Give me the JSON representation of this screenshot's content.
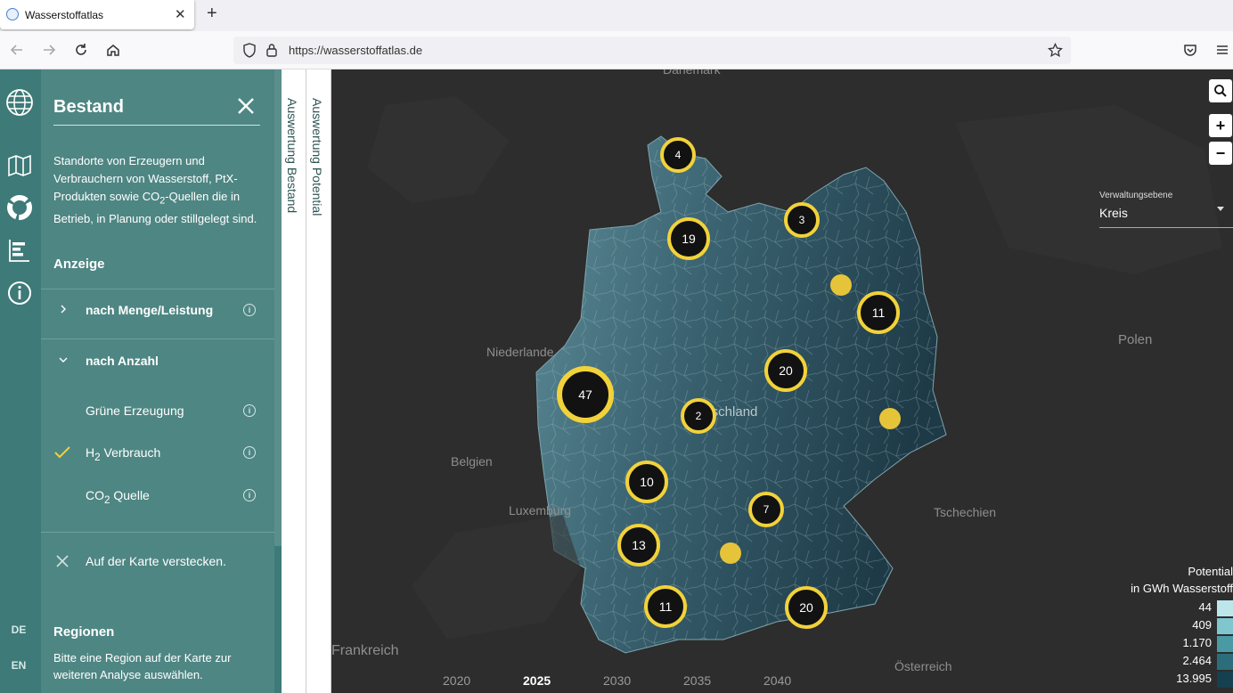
{
  "browser": {
    "tab_title": "Wasserstoffatlas",
    "new_tab": "+",
    "url": "https://wasserstoffatlas.de"
  },
  "panel": {
    "title": "Bestand",
    "description_html": "Standorte von Erzeugern und Verbrauchern von Wasserstoff, PtX-Produkten sowie CO<sub>2</sub>-Quellen die in Betrieb, in Planung oder stillgelegt sind.",
    "anzeige": "Anzeige",
    "rows": {
      "menge": "nach Menge/Leistung",
      "anzahl": "nach Anzahl",
      "gruen": "Grüne Erzeugung",
      "h2_html": "H<sub>2</sub> Verbrauch",
      "co2_html": "CO<sub>2</sub> Quelle",
      "hide": "Auf der Karte verstecken."
    },
    "regionen": "Regionen",
    "regionen_text": "Bitte eine Region auf der Karte zur weiteren Analyse auswählen."
  },
  "rail": {
    "lang_de": "DE",
    "lang_en": "EN"
  },
  "vtabs": {
    "bestand": "Auswertung Bestand",
    "potential": "Auswertung Potential"
  },
  "map": {
    "countries": {
      "daenemark": "Dänemark",
      "niederlande": "Niederlande",
      "belgien": "Belgien",
      "luxemburg": "Luxemburg",
      "frankreich": "Frankreich",
      "polen": "Polen",
      "tschechien": "Tschechien",
      "oesterreich": "Österreich",
      "deutschland": "Deutschland"
    },
    "clusters": [
      "4",
      "3",
      "19",
      "11",
      "47",
      "20",
      "2",
      "10",
      "7",
      "13",
      "11",
      "20"
    ],
    "zoom_in": "+",
    "zoom_out": "−",
    "verwaltung_label": "Verwaltungsebene",
    "verwaltung_value": "Kreis",
    "legend_title": "Potential",
    "legend_unit": "in GWh Wasserstoff",
    "legend_values": [
      "44",
      "409",
      "1.170",
      "2.464",
      "13.995"
    ],
    "legend_colors": [
      "#bde6ea",
      "#7fc6cf",
      "#4a9aa6",
      "#2b6d7b",
      "#16404f"
    ],
    "years": [
      "2020",
      "2025",
      "2030",
      "2035",
      "2040"
    ],
    "marker_color": "#f2d23a",
    "accent": "#4e8683"
  }
}
